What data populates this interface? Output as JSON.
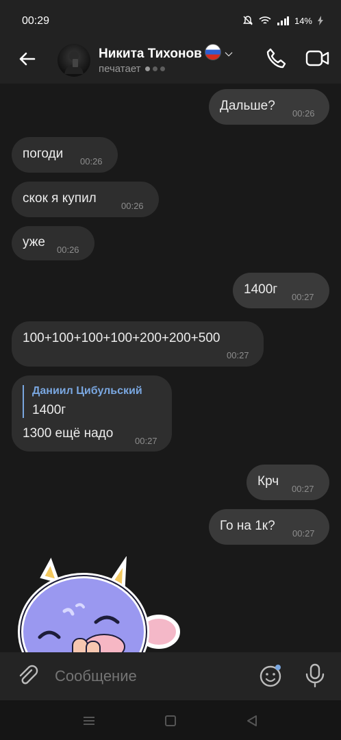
{
  "status": {
    "time": "00:29",
    "battery": "14%"
  },
  "header": {
    "contact_name": "Никита Тихонов",
    "status_text": "печатает"
  },
  "messages": [
    {
      "text": "Дальше?",
      "time": "00:26",
      "dir": "out"
    },
    {
      "text": "погоди",
      "time": "00:26",
      "dir": "in"
    },
    {
      "text": "скок я купил",
      "time": "00:26",
      "dir": "in"
    },
    {
      "text": "уже",
      "time": "00:26",
      "dir": "in"
    },
    {
      "text": "1400г",
      "time": "00:27",
      "dir": "out"
    },
    {
      "text": "100+100+100+100+200+200+500",
      "time": "00:27",
      "dir": "in"
    },
    {
      "reply_author": "Даниил Цибульский",
      "reply_text": "1400г",
      "text": "1300 ещё надо",
      "time": "00:27",
      "dir": "in"
    },
    {
      "text": "Крч",
      "time": "00:27",
      "dir": "out"
    },
    {
      "text": "Го на 1к?",
      "time": "00:27",
      "dir": "out"
    }
  ],
  "composer": {
    "placeholder": "Сообщение"
  },
  "colors": {
    "background": "#191919",
    "bubble": "#2e2e2e",
    "accent": "#7aa7e0"
  },
  "icons": [
    "back-arrow-icon",
    "phone-icon",
    "video-camera-icon",
    "paperclip-icon",
    "emoji-icon",
    "microphone-icon"
  ]
}
